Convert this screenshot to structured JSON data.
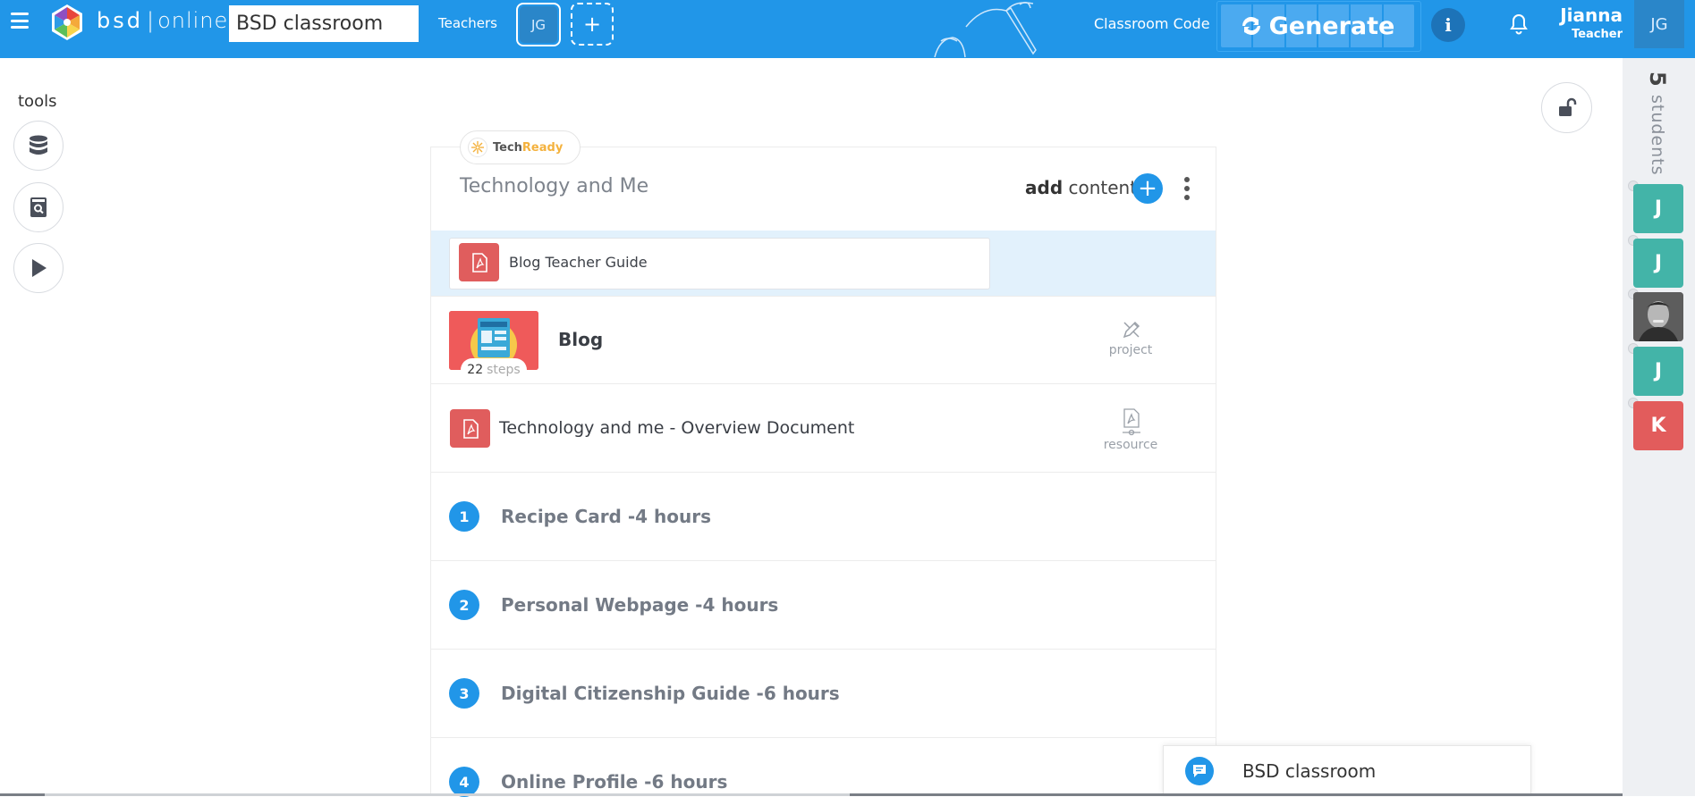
{
  "header": {
    "brand_left": "bsd",
    "brand_right": "online",
    "classroom_name": "BSD classroom",
    "teachers_label": "Teachers",
    "teacher_initials": "JG",
    "classroom_code_label": "Classroom Code",
    "generate_label": "Generate",
    "info_label": "i",
    "user_name": "Jianna",
    "user_role": "Teacher",
    "user_initials": "JG",
    "color": "#2196e8"
  },
  "tools": {
    "label": "tools",
    "items": [
      {
        "name": "database",
        "icon": "database-icon"
      },
      {
        "name": "search-book",
        "icon": "search-book-icon"
      },
      {
        "name": "play",
        "icon": "play-icon"
      }
    ]
  },
  "students": {
    "count": "5",
    "label": "students",
    "list": [
      {
        "initial": "J",
        "color": "#43b4a8"
      },
      {
        "initial": "J",
        "color": "#43b4a8"
      },
      {
        "initial": "",
        "photo": true
      },
      {
        "initial": "J",
        "color": "#43b4a8"
      },
      {
        "initial": "K",
        "color": "#e25c5c"
      }
    ]
  },
  "unit": {
    "badge_part1": "Tech",
    "badge_part2": "Ready",
    "title": "Technology and Me",
    "add_bold": "add",
    "add_rest": "content",
    "plus": "+",
    "guide": "Blog Teacher Guide",
    "project": {
      "title": "Blog",
      "steps": "22",
      "steps_label": "steps",
      "type": "project"
    },
    "resource": {
      "title": "Technology and me - Overview Document",
      "type": "resource"
    },
    "lessons": [
      {
        "num": "1",
        "title": "Recipe Card -4 hours"
      },
      {
        "num": "2",
        "title": "Personal Webpage -4 hours"
      },
      {
        "num": "3",
        "title": "Digital Citizenship Guide -6 hours"
      },
      {
        "num": "4",
        "title": "Online Profile -6 hours"
      }
    ]
  },
  "chat": {
    "title": "BSD classroom"
  }
}
